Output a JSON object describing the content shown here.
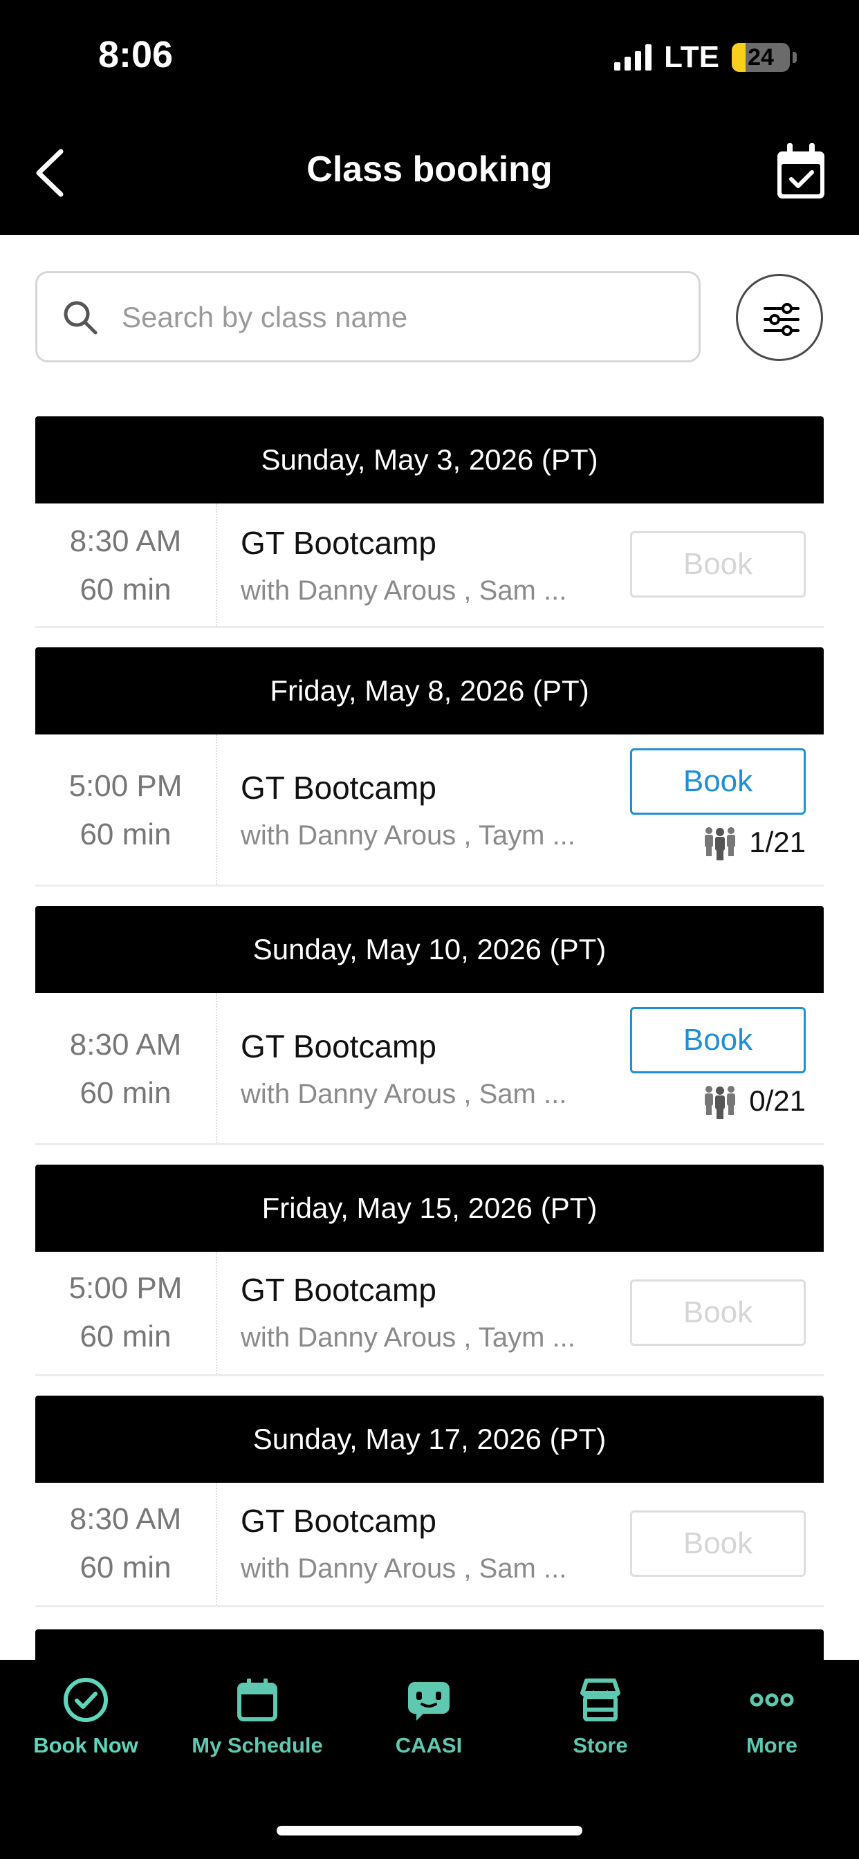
{
  "status_bar": {
    "time": "8:06",
    "network": "LTE",
    "battery_level": "24",
    "battery_fraction": 0.24,
    "battery_color": "#f7cf1c"
  },
  "header": {
    "title": "Class booking",
    "back_icon": "chevron-left-icon",
    "calendar_icon": "calendar-check-icon"
  },
  "search": {
    "placeholder": "Search by class name",
    "value": "",
    "filter_icon": "sliders-icon"
  },
  "days": [
    {
      "date": "Sunday, May 3, 2026 (PT)",
      "classes": [
        {
          "time": "8:30  AM",
          "duration": "60 min",
          "name": "GT Bootcamp",
          "instructors": "with Danny Arous , Sam ...",
          "button": "Book",
          "enabled": false,
          "capacity": ""
        }
      ]
    },
    {
      "date": "Friday, May 8, 2026 (PT)",
      "classes": [
        {
          "time": "5:00  PM",
          "duration": "60 min",
          "name": "GT Bootcamp",
          "instructors": "with Danny Arous , Taym ...",
          "button": "Book",
          "enabled": true,
          "capacity": "1/21"
        }
      ]
    },
    {
      "date": "Sunday, May 10, 2026 (PT)",
      "classes": [
        {
          "time": "8:30  AM",
          "duration": "60 min",
          "name": "GT Bootcamp",
          "instructors": "with Danny Arous , Sam ...",
          "button": "Book",
          "enabled": true,
          "capacity": "0/21"
        }
      ]
    },
    {
      "date": "Friday, May 15, 2026 (PT)",
      "classes": [
        {
          "time": "5:00  PM",
          "duration": "60 min",
          "name": "GT Bootcamp",
          "instructors": "with Danny Arous , Taym ...",
          "button": "Book",
          "enabled": false,
          "capacity": ""
        }
      ]
    },
    {
      "date": "Sunday, May 17, 2026 (PT)",
      "classes": [
        {
          "time": "8:30  AM",
          "duration": "60 min",
          "name": "GT Bootcamp",
          "instructors": "with Danny Arous , Sam ...",
          "button": "Book",
          "enabled": false,
          "capacity": ""
        }
      ]
    }
  ],
  "tabs": [
    {
      "label": "Book Now",
      "icon": "check-circle-icon",
      "active": true
    },
    {
      "label": "My Schedule",
      "icon": "calendar-icon",
      "active": false
    },
    {
      "label": "CAASI",
      "icon": "chat-bot-icon",
      "active": false
    },
    {
      "label": "Store",
      "icon": "store-icon",
      "active": false
    },
    {
      "label": "More",
      "icon": "more-dots-icon",
      "active": false
    }
  ],
  "colors": {
    "accent_tab": "#5ec8b1",
    "book_active": "#1c8fd6",
    "book_disabled": "#d5d5d5"
  }
}
